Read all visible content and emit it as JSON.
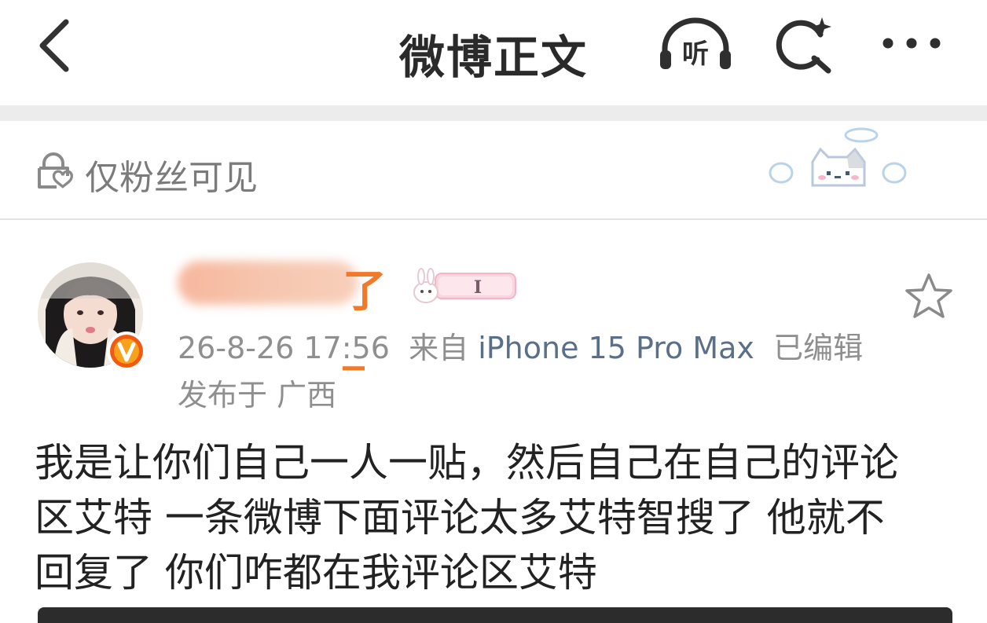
{
  "header": {
    "title": "微博正文",
    "listen_label": "听"
  },
  "visibility": {
    "text": "仅粉丝可见"
  },
  "post": {
    "username_visible": "了_",
    "tag_label": "I",
    "time": "26-8-26 17:56",
    "source_prefix": "来自",
    "source": "iPhone 15 Pro Max",
    "edited": "已编辑",
    "location": "发布于 广西",
    "content_lines": [
      "我是让你们自己一人一贴，然后自己在自己的评论",
      "区艾特  一条微博下面评论太多艾特智搜了 他就不",
      "回复了 你们咋都在我评论区艾特"
    ]
  },
  "colors": {
    "accent_orange": "#f08a3c",
    "source_link": "#5a6f8a",
    "muted_text": "#8f8f8f",
    "verified_badge": "#f25a12"
  },
  "icons": [
    "back-arrow-icon",
    "headphones-icon",
    "search-sparkle-icon",
    "more-icon",
    "lock-icon",
    "cat-sticker-icon",
    "verified-v-icon",
    "star-icon"
  ]
}
